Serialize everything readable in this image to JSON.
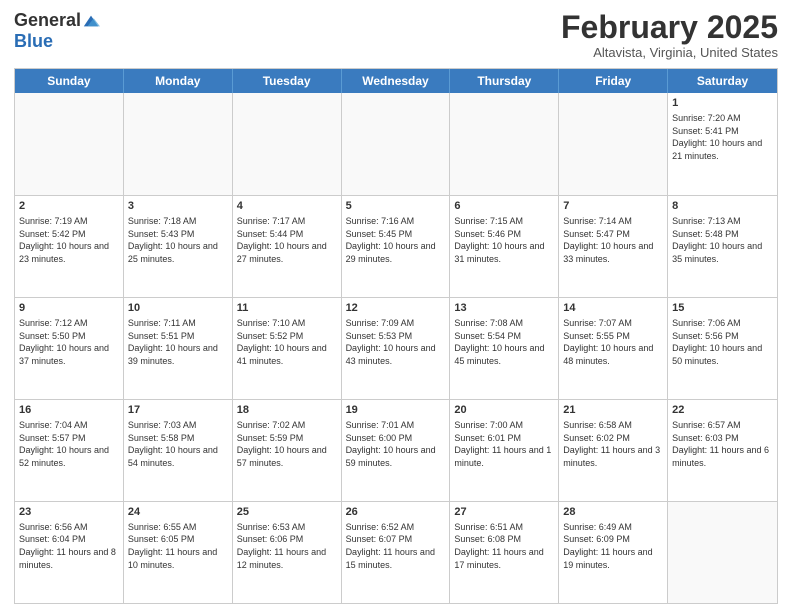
{
  "logo": {
    "general": "General",
    "blue": "Blue"
  },
  "header": {
    "month": "February 2025",
    "location": "Altavista, Virginia, United States"
  },
  "dayHeaders": [
    "Sunday",
    "Monday",
    "Tuesday",
    "Wednesday",
    "Thursday",
    "Friday",
    "Saturday"
  ],
  "weeks": [
    [
      {
        "num": "",
        "info": ""
      },
      {
        "num": "",
        "info": ""
      },
      {
        "num": "",
        "info": ""
      },
      {
        "num": "",
        "info": ""
      },
      {
        "num": "",
        "info": ""
      },
      {
        "num": "",
        "info": ""
      },
      {
        "num": "1",
        "info": "Sunrise: 7:20 AM\nSunset: 5:41 PM\nDaylight: 10 hours and 21 minutes."
      }
    ],
    [
      {
        "num": "2",
        "info": "Sunrise: 7:19 AM\nSunset: 5:42 PM\nDaylight: 10 hours and 23 minutes."
      },
      {
        "num": "3",
        "info": "Sunrise: 7:18 AM\nSunset: 5:43 PM\nDaylight: 10 hours and 25 minutes."
      },
      {
        "num": "4",
        "info": "Sunrise: 7:17 AM\nSunset: 5:44 PM\nDaylight: 10 hours and 27 minutes."
      },
      {
        "num": "5",
        "info": "Sunrise: 7:16 AM\nSunset: 5:45 PM\nDaylight: 10 hours and 29 minutes."
      },
      {
        "num": "6",
        "info": "Sunrise: 7:15 AM\nSunset: 5:46 PM\nDaylight: 10 hours and 31 minutes."
      },
      {
        "num": "7",
        "info": "Sunrise: 7:14 AM\nSunset: 5:47 PM\nDaylight: 10 hours and 33 minutes."
      },
      {
        "num": "8",
        "info": "Sunrise: 7:13 AM\nSunset: 5:48 PM\nDaylight: 10 hours and 35 minutes."
      }
    ],
    [
      {
        "num": "9",
        "info": "Sunrise: 7:12 AM\nSunset: 5:50 PM\nDaylight: 10 hours and 37 minutes."
      },
      {
        "num": "10",
        "info": "Sunrise: 7:11 AM\nSunset: 5:51 PM\nDaylight: 10 hours and 39 minutes."
      },
      {
        "num": "11",
        "info": "Sunrise: 7:10 AM\nSunset: 5:52 PM\nDaylight: 10 hours and 41 minutes."
      },
      {
        "num": "12",
        "info": "Sunrise: 7:09 AM\nSunset: 5:53 PM\nDaylight: 10 hours and 43 minutes."
      },
      {
        "num": "13",
        "info": "Sunrise: 7:08 AM\nSunset: 5:54 PM\nDaylight: 10 hours and 45 minutes."
      },
      {
        "num": "14",
        "info": "Sunrise: 7:07 AM\nSunset: 5:55 PM\nDaylight: 10 hours and 48 minutes."
      },
      {
        "num": "15",
        "info": "Sunrise: 7:06 AM\nSunset: 5:56 PM\nDaylight: 10 hours and 50 minutes."
      }
    ],
    [
      {
        "num": "16",
        "info": "Sunrise: 7:04 AM\nSunset: 5:57 PM\nDaylight: 10 hours and 52 minutes."
      },
      {
        "num": "17",
        "info": "Sunrise: 7:03 AM\nSunset: 5:58 PM\nDaylight: 10 hours and 54 minutes."
      },
      {
        "num": "18",
        "info": "Sunrise: 7:02 AM\nSunset: 5:59 PM\nDaylight: 10 hours and 57 minutes."
      },
      {
        "num": "19",
        "info": "Sunrise: 7:01 AM\nSunset: 6:00 PM\nDaylight: 10 hours and 59 minutes."
      },
      {
        "num": "20",
        "info": "Sunrise: 7:00 AM\nSunset: 6:01 PM\nDaylight: 11 hours and 1 minute."
      },
      {
        "num": "21",
        "info": "Sunrise: 6:58 AM\nSunset: 6:02 PM\nDaylight: 11 hours and 3 minutes."
      },
      {
        "num": "22",
        "info": "Sunrise: 6:57 AM\nSunset: 6:03 PM\nDaylight: 11 hours and 6 minutes."
      }
    ],
    [
      {
        "num": "23",
        "info": "Sunrise: 6:56 AM\nSunset: 6:04 PM\nDaylight: 11 hours and 8 minutes."
      },
      {
        "num": "24",
        "info": "Sunrise: 6:55 AM\nSunset: 6:05 PM\nDaylight: 11 hours and 10 minutes."
      },
      {
        "num": "25",
        "info": "Sunrise: 6:53 AM\nSunset: 6:06 PM\nDaylight: 11 hours and 12 minutes."
      },
      {
        "num": "26",
        "info": "Sunrise: 6:52 AM\nSunset: 6:07 PM\nDaylight: 11 hours and 15 minutes."
      },
      {
        "num": "27",
        "info": "Sunrise: 6:51 AM\nSunset: 6:08 PM\nDaylight: 11 hours and 17 minutes."
      },
      {
        "num": "28",
        "info": "Sunrise: 6:49 AM\nSunset: 6:09 PM\nDaylight: 11 hours and 19 minutes."
      },
      {
        "num": "",
        "info": ""
      }
    ]
  ]
}
